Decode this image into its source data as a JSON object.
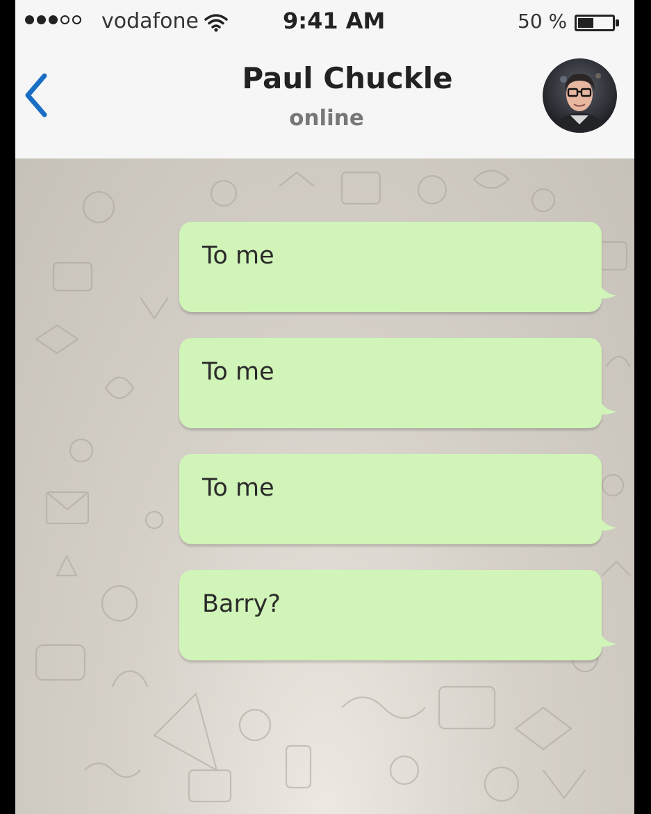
{
  "status_bar": {
    "carrier": "vodafone",
    "time": "9:41 AM",
    "battery_percent": "50 %",
    "battery_level": 0.5,
    "signal_bars_filled": 3,
    "signal_bars_total": 5,
    "icons": [
      "signal-dots-icon",
      "wifi-icon",
      "battery-icon"
    ]
  },
  "header": {
    "back_icon": "chevron-left-icon",
    "contact_name": "Paul Chuckle",
    "contact_status": "online",
    "avatar_icon": "contact-avatar"
  },
  "chat": {
    "messages": [
      {
        "direction": "outgoing",
        "text": "To me"
      },
      {
        "direction": "outgoing",
        "text": "To me"
      },
      {
        "direction": "outgoing",
        "text": "To me"
      },
      {
        "direction": "outgoing",
        "text": "Barry?"
      }
    ]
  },
  "colors": {
    "outgoing_bubble": "#d1f4b8",
    "accent_back": "#1a6fc4",
    "chat_background": "#d6d1c9",
    "header_background": "#f6f6f6"
  }
}
